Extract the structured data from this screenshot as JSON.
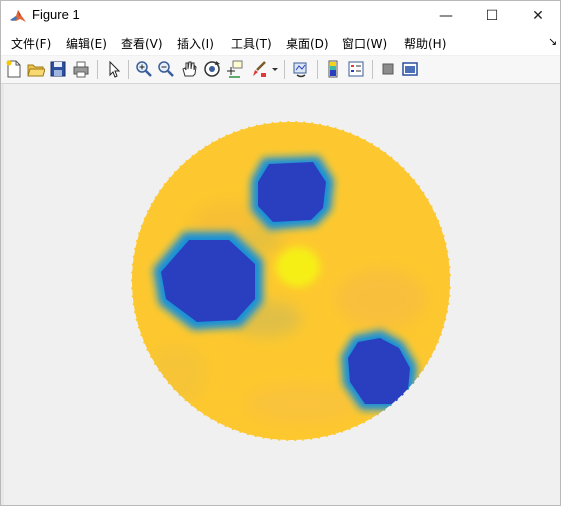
{
  "window": {
    "title": "Figure 1",
    "minimize_glyph": "—",
    "maximize_glyph": "☐",
    "close_glyph": "✕"
  },
  "menu": {
    "items": [
      "文件(F)",
      "编辑(E)",
      "查看(V)",
      "插入(I)",
      "工具(T)",
      "桌面(D)",
      "窗口(W)",
      "帮助(H)"
    ],
    "overflow_glyph": "↘"
  },
  "toolbar": {
    "icons": [
      "new-figure-icon",
      "open-file-icon",
      "save-icon",
      "print-icon",
      "edit-plot-arrow-icon",
      "zoom-in-icon",
      "zoom-out-icon",
      "pan-hand-icon",
      "rotate-3d-icon",
      "data-cursor-icon",
      "brush-icon",
      "brush-dropdown-icon",
      "link-plot-icon",
      "insert-colorbar-icon",
      "insert-legend-icon",
      "hide-plot-tools-icon",
      "show-plot-tools-icon"
    ]
  },
  "colors": {
    "background_yellow": "#fdc82f",
    "inclusion_blue": "#2a3fbf",
    "inclusion_edge": "#1590d8",
    "figure_bg": "#f0f0f0"
  }
}
